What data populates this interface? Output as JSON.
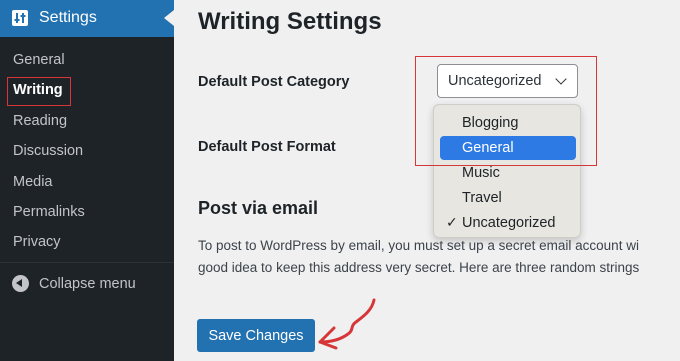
{
  "sidebar": {
    "header": {
      "title": "Settings",
      "icon": "settings-sliders-icon"
    },
    "items": [
      {
        "label": "General"
      },
      {
        "label": "Writing"
      },
      {
        "label": "Reading"
      },
      {
        "label": "Discussion"
      },
      {
        "label": "Media"
      },
      {
        "label": "Permalinks"
      },
      {
        "label": "Privacy"
      }
    ],
    "current": "Writing",
    "collapse_label": "Collapse menu",
    "collapse_icon": "collapse-left-icon"
  },
  "page": {
    "title": "Writing Settings",
    "fields": {
      "default_category": {
        "label": "Default Post Category",
        "value": "Uncategorized",
        "options": [
          "Blogging",
          "General",
          "Music",
          "Travel",
          "Uncategorized"
        ],
        "highlighted": "General",
        "checked": "Uncategorized"
      },
      "default_format": {
        "label": "Default Post Format"
      }
    },
    "post_via_email": {
      "heading": "Post via email",
      "line1": "To post to WordPress by email, you must set up a secret email account wi",
      "line2": "good idea to keep this address very secret. Here are three random strings"
    },
    "save_button": "Save Changes"
  },
  "colors": {
    "admin_blue": "#2271b1",
    "sidebar_bg": "#1d2327",
    "highlight_red": "#d63638",
    "dropdown_selected": "#2e7ae4"
  }
}
